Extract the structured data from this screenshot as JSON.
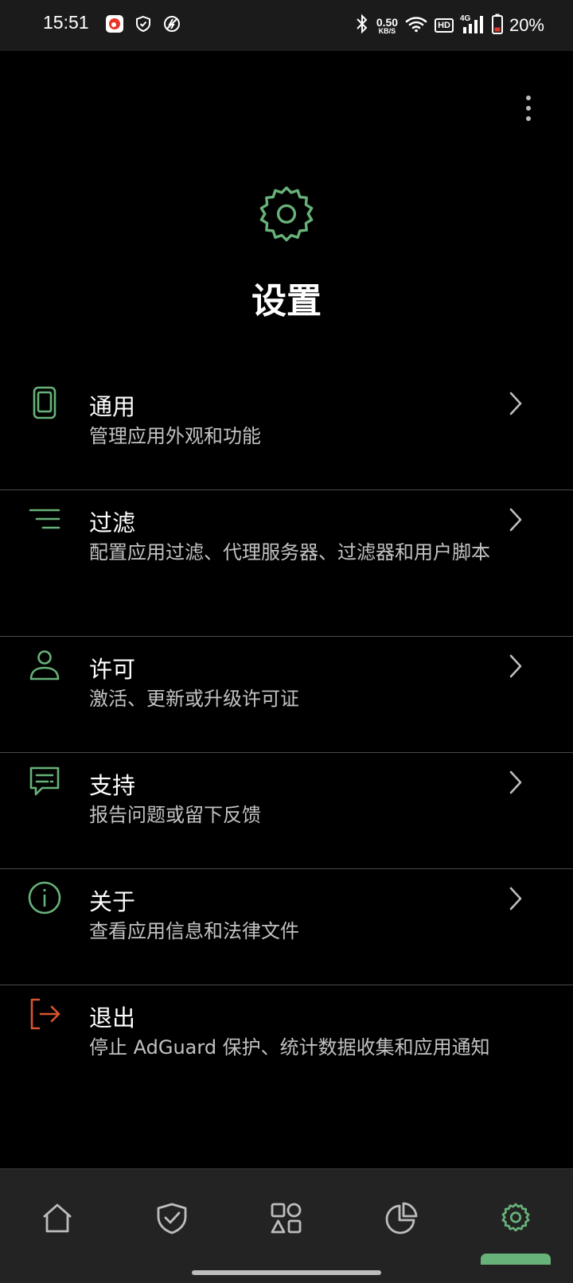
{
  "status_bar": {
    "time": "15:51",
    "net_speed_value": "0.50",
    "net_speed_unit": "KB/S",
    "hd_label": "HD",
    "network_type": "4G",
    "battery_percent": "20%",
    "icons": [
      "weibo-app-icon",
      "vpn-shield-icon",
      "no-sync-icon",
      "bluetooth-icon",
      "wifi-icon",
      "signal-icon",
      "battery-icon"
    ]
  },
  "header": {
    "title": "设置",
    "icon": "gear-icon",
    "accent_color": "#67b279"
  },
  "settings": [
    {
      "icon": "phone-icon",
      "title": "通用",
      "subtitle": "管理应用外观和功能"
    },
    {
      "icon": "filter-lines-icon",
      "title": "过滤",
      "subtitle": "配置应用过滤、代理服务器、过滤器和用户脚本"
    },
    {
      "icon": "user-icon",
      "title": "许可",
      "subtitle": "激活、更新或升级许可证"
    },
    {
      "icon": "chat-icon",
      "title": "支持",
      "subtitle": "报告问题或留下反馈"
    },
    {
      "icon": "info-icon",
      "title": "关于",
      "subtitle": "查看应用信息和法律文件"
    },
    {
      "icon": "exit-icon",
      "title": "退出",
      "subtitle": "停止 AdGuard 保护、统计数据收集和应用通知",
      "icon_color": "#d9542e"
    }
  ],
  "bottom_nav": {
    "items": [
      "home-icon",
      "shield-check-icon",
      "apps-grid-icon",
      "stats-pie-icon",
      "gear-icon"
    ],
    "active": "gear-icon",
    "active_color": "#67b279",
    "inactive_color": "#bdbdbd"
  }
}
